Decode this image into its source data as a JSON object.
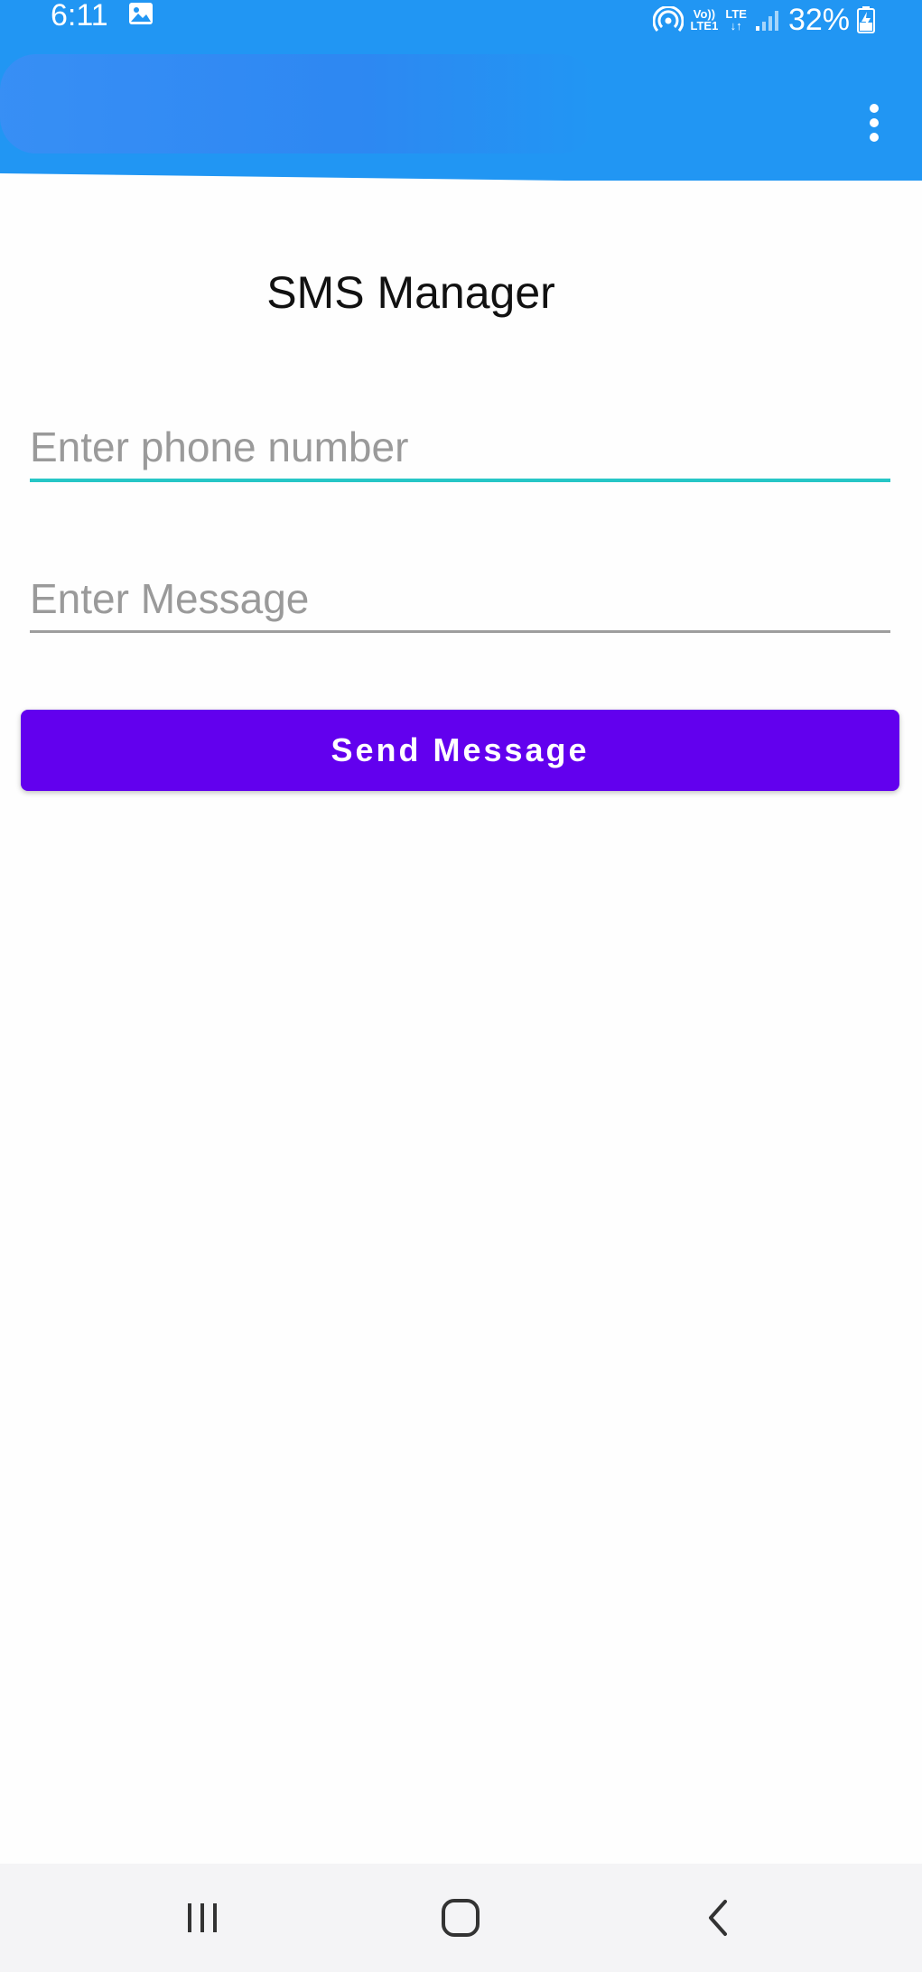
{
  "status_bar": {
    "time": "6:11",
    "network_top": "Vo))",
    "network_bottom": "LTE1",
    "lte_label": "LTE",
    "lte_arrows": "↓↑",
    "battery": "32%"
  },
  "app_bar": {
    "menu_icon": "more-vert-icon",
    "color": "#2196f3"
  },
  "main": {
    "title": "SMS Manager",
    "phone_placeholder": "Enter phone number",
    "phone_value": "",
    "message_placeholder": "Enter Message",
    "message_value": "",
    "send_label": "Send Message",
    "accent_color": "#6200ee",
    "focus_color": "#26c6c6"
  },
  "nav_bar": {
    "recents_icon": "recents-icon",
    "home_icon": "home-icon",
    "back_icon": "back-icon"
  }
}
